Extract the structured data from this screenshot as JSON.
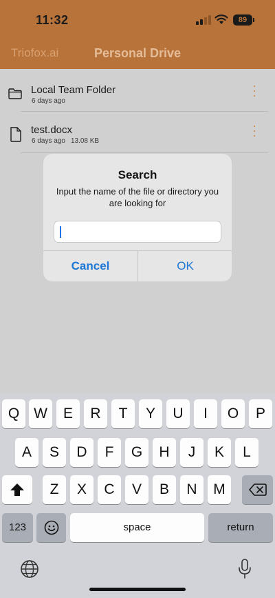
{
  "status_bar": {
    "time": "11:32",
    "battery": "89"
  },
  "header": {
    "brand": "Triofox.ai",
    "title": "Personal Drive"
  },
  "files": [
    {
      "name": "Local Team Folder",
      "modified": "6 days ago",
      "size": "",
      "icon": "folder-icon"
    },
    {
      "name": "test.docx",
      "modified": "6 days ago",
      "size": "13.08 KB",
      "icon": "file-icon"
    }
  ],
  "dialog": {
    "title": "Search",
    "message": "Input the name of the file or directory you are looking for",
    "input_value": "",
    "cancel": "Cancel",
    "ok": "OK"
  },
  "keyboard": {
    "row1": [
      "Q",
      "W",
      "E",
      "R",
      "T",
      "Y",
      "U",
      "I",
      "O",
      "P"
    ],
    "row2": [
      "A",
      "S",
      "D",
      "F",
      "G",
      "H",
      "J",
      "K",
      "L"
    ],
    "row3": [
      "Z",
      "X",
      "C",
      "V",
      "B",
      "N",
      "M"
    ],
    "numbers": "123",
    "space": "space",
    "return": "return"
  },
  "colors": {
    "header": "#b8733a",
    "accent": "#1d77d6",
    "kebab": "#c98434"
  }
}
